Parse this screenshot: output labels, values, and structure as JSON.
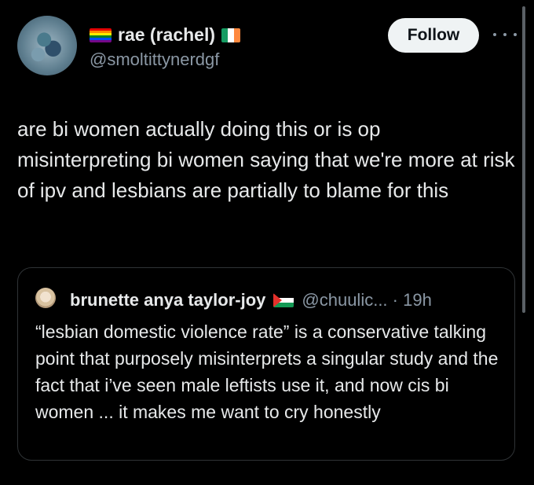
{
  "tweet": {
    "author": {
      "display_name": "rae (rachel)",
      "handle": "@smoltittynerdgf",
      "flags": [
        "pride-flag",
        "ireland-flag"
      ]
    },
    "follow_label": "Follow",
    "text": "are bi women actually doing this or is op misinterpreting bi women saying that we're more at risk of ipv and lesbians are partially to blame for this"
  },
  "quote": {
    "display_name": "brunette anya taylor-joy",
    "handle": "@chuulic...",
    "separator": "·",
    "time": "19h",
    "flag": "palestine-flag",
    "text": "“lesbian domestic violence rate” is a conservative talking point that purposely misinterprets a singular study and the fact that i’ve seen male leftists use it, and now cis bi women ... it makes me want to cry honestly"
  },
  "colors": {
    "background": "#000000",
    "text": "#e7e9ea",
    "secondary": "#8b98a5",
    "follow_bg": "#eff3f4",
    "border": "#2f3336"
  }
}
